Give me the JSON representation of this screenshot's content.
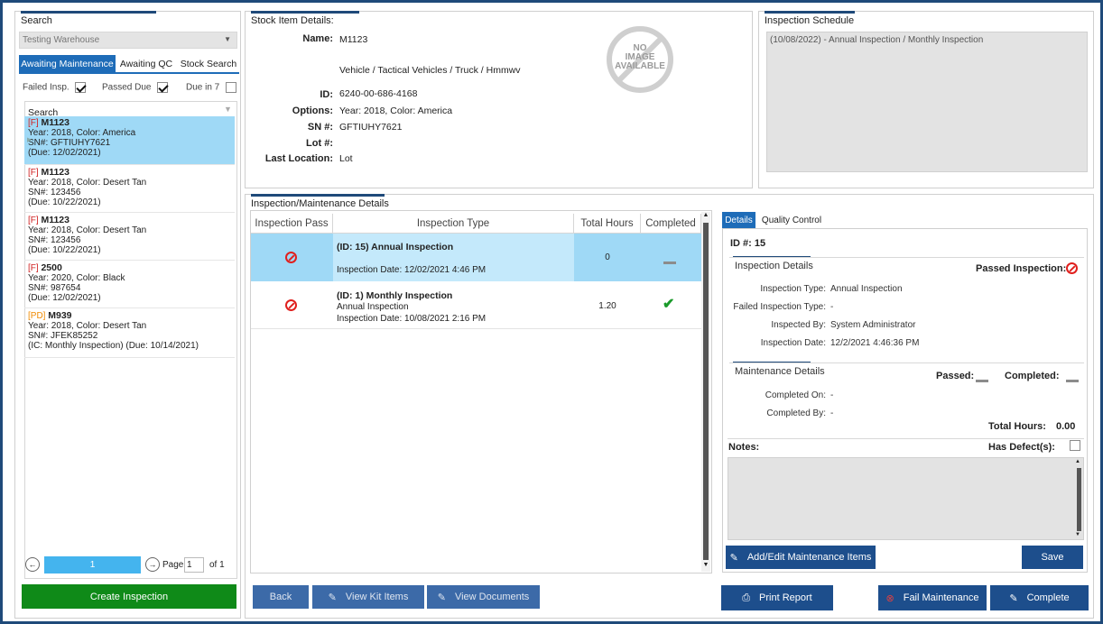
{
  "search_panel": {
    "title": "Search",
    "warehouse_value": "Testing Warehouse",
    "tabs": [
      "Awaiting Maintenance",
      "Awaiting QC",
      "Stock Search"
    ],
    "filters": {
      "failed_label": "Failed Insp.",
      "passed_label": "Passed Due",
      "due7_label": "Due in 7"
    },
    "list_header": "Search",
    "items": [
      {
        "tag": "[F]",
        "name": "M1123",
        "line1": "Year: 2018, Color: America",
        "line2": "SN#: GFTIUHY7621",
        "line3": " (Due: 12/02/2021)"
      },
      {
        "tag": "[F]",
        "name": "M1123",
        "line1": "Year: 2018, Color: Desert Tan",
        "line2": "SN#: 123456",
        "line3": " (Due: 10/22/2021)"
      },
      {
        "tag": "[F]",
        "name": "M1123",
        "line1": "Year: 2018, Color: Desert Tan",
        "line2": "SN#: 123456",
        "line3": " (Due: 10/22/2021)"
      },
      {
        "tag": "[F]",
        "name": "2500",
        "line1": "Year: 2020, Color: Black",
        "line2": "SN#: 987654",
        "line3": " (Due: 12/02/2021)"
      },
      {
        "tag": "[PD]",
        "name": "M939",
        "line1": "Year: 2018, Color: Desert Tan",
        "line2": "SN#: JFEK85252",
        "line3": "(IC: Monthly Inspection) (Due: 10/14/2021)"
      }
    ],
    "pager": {
      "current": "1",
      "page_label": "Page",
      "page_value": "1",
      "of_label": "of 1"
    },
    "create_button": "Create Inspection"
  },
  "stock_details": {
    "title": "Stock Item Details:",
    "name_label": "Name:",
    "name_value": "M1123",
    "category": "Vehicle / Tactical Vehicles / Truck / Hmmwv",
    "id_label": "ID:",
    "id_value": "6240-00-686-4168",
    "options_label": "Options:",
    "options_value": "Year: 2018, Color: America",
    "sn_label": "SN #:",
    "sn_value": "GFTIUHY7621",
    "lot_label": "Lot #:",
    "lot_value": "",
    "location_label": "Last Location:",
    "location_value": "Lot",
    "no_image_text": [
      "NO",
      "IMAGE",
      "AVAILABLE"
    ]
  },
  "schedule": {
    "title": "Inspection Schedule",
    "entry": "(10/08/2022) - Annual Inspection / Monthly Inspection"
  },
  "inspection_grid": {
    "title": "Inspection/Maintenance Details",
    "columns": [
      "Inspection Pass",
      "Inspection Type",
      "Total Hours",
      "Completed"
    ],
    "rows": [
      {
        "type_title": "(ID: 15) Annual Inspection",
        "type_sub": "",
        "date": "Inspection Date: 12/02/2021 4:46 PM",
        "hours": "0",
        "completed": "dash"
      },
      {
        "type_title": "(ID: 1) Monthly Inspection",
        "type_sub": "Annual Inspection",
        "date": "Inspection Date: 10/08/2021 2:16 PM",
        "hours": "1.20",
        "completed": "check"
      }
    ]
  },
  "bottom_buttons": {
    "back": "Back",
    "view_kit": "View Kit Items",
    "view_docs": "View Documents",
    "print": "Print Report",
    "fail": "Fail Maintenance",
    "complete": "Complete"
  },
  "details": {
    "tabs": [
      "Details",
      "Quality Control"
    ],
    "id_line": "ID #:  15",
    "inspection_section": "Inspection Details",
    "passed_label": "Passed Inspection:",
    "insp_type_label": "Inspection Type:",
    "insp_type_value": "Annual Inspection",
    "failed_type_label": "Failed Inspection Type:",
    "failed_type_value": "-",
    "inspected_by_label": "Inspected By:",
    "inspected_by_value": "System Administrator",
    "insp_date_label": "Inspection Date:",
    "insp_date_value": "12/2/2021 4:46:36 PM",
    "maintenance_section": "Maintenance Details",
    "passed_short": "Passed:",
    "completed_short": "Completed:",
    "completed_on_label": "Completed On:",
    "completed_on_value": "-",
    "completed_by_label": "Completed By:",
    "completed_by_value": "-",
    "total_hours_label": "Total Hours:",
    "total_hours_value": "0.00",
    "notes_label": "Notes:",
    "defects_label": "Has Defect(s):",
    "add_edit_button": "Add/Edit Maintenance Items",
    "save_button": "Save"
  },
  "colors": {
    "frame": "#1f4a7a",
    "button": "#1d4e8c",
    "selected_row": "#9fd9f6",
    "create_button": "#0f8a18",
    "fail_red": "#e0201e"
  }
}
